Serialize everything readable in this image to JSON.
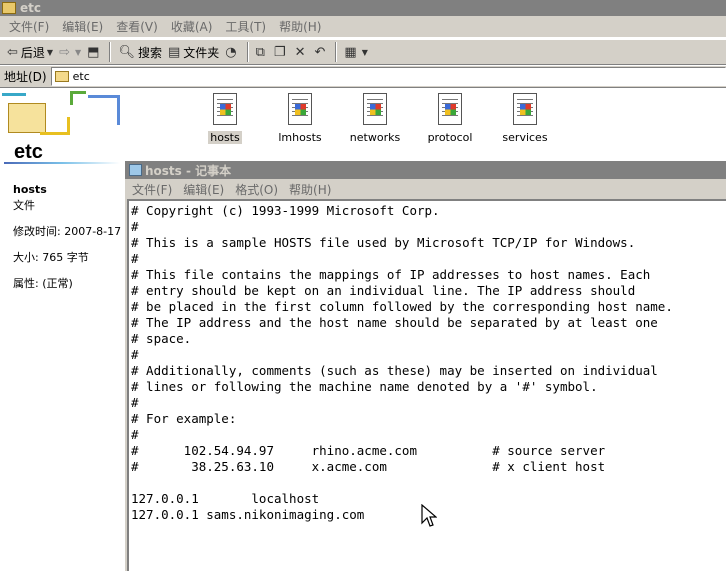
{
  "explorer": {
    "title": "etc",
    "menu": [
      "文件(F)",
      "编辑(E)",
      "查看(V)",
      "收藏(A)",
      "工具(T)",
      "帮助(H)"
    ],
    "toolbar": {
      "back": "后退",
      "search": "搜索",
      "folders": "文件夹"
    },
    "address_label": "地址(D)",
    "address_value": "etc"
  },
  "info_pane": {
    "folder_title": "etc",
    "selected_name": "hosts",
    "selected_type": "文件",
    "modified": "修改时间: 2007-8-17",
    "size": "大小: 765 字节",
    "attributes": "属性: (正常)"
  },
  "files": [
    {
      "name": "hosts",
      "selected": true
    },
    {
      "name": "lmhosts",
      "selected": false
    },
    {
      "name": "networks",
      "selected": false
    },
    {
      "name": "protocol",
      "selected": false
    },
    {
      "name": "services",
      "selected": false
    }
  ],
  "notepad": {
    "title": "hosts - 记事本",
    "menu": [
      "文件(F)",
      "编辑(E)",
      "格式(O)",
      "帮助(H)"
    ],
    "lines": [
      "# Copyright (c) 1993-1999 Microsoft Corp.",
      "#",
      "# This is a sample HOSTS file used by Microsoft TCP/IP for Windows.",
      "#",
      "# This file contains the mappings of IP addresses to host names. Each",
      "# entry should be kept on an individual line. The IP address should",
      "# be placed in the first column followed by the corresponding host name.",
      "# The IP address and the host name should be separated by at least one",
      "# space.",
      "#",
      "# Additionally, comments (such as these) may be inserted on individual",
      "# lines or following the machine name denoted by a '#' symbol.",
      "#",
      "# For example:",
      "#",
      "#      102.54.94.97     rhino.acme.com          # source server",
      "#       38.25.63.10     x.acme.com              # x client host",
      "",
      "127.0.0.1       localhost",
      "127.0.0.1 sams.nikonimaging.com"
    ]
  }
}
